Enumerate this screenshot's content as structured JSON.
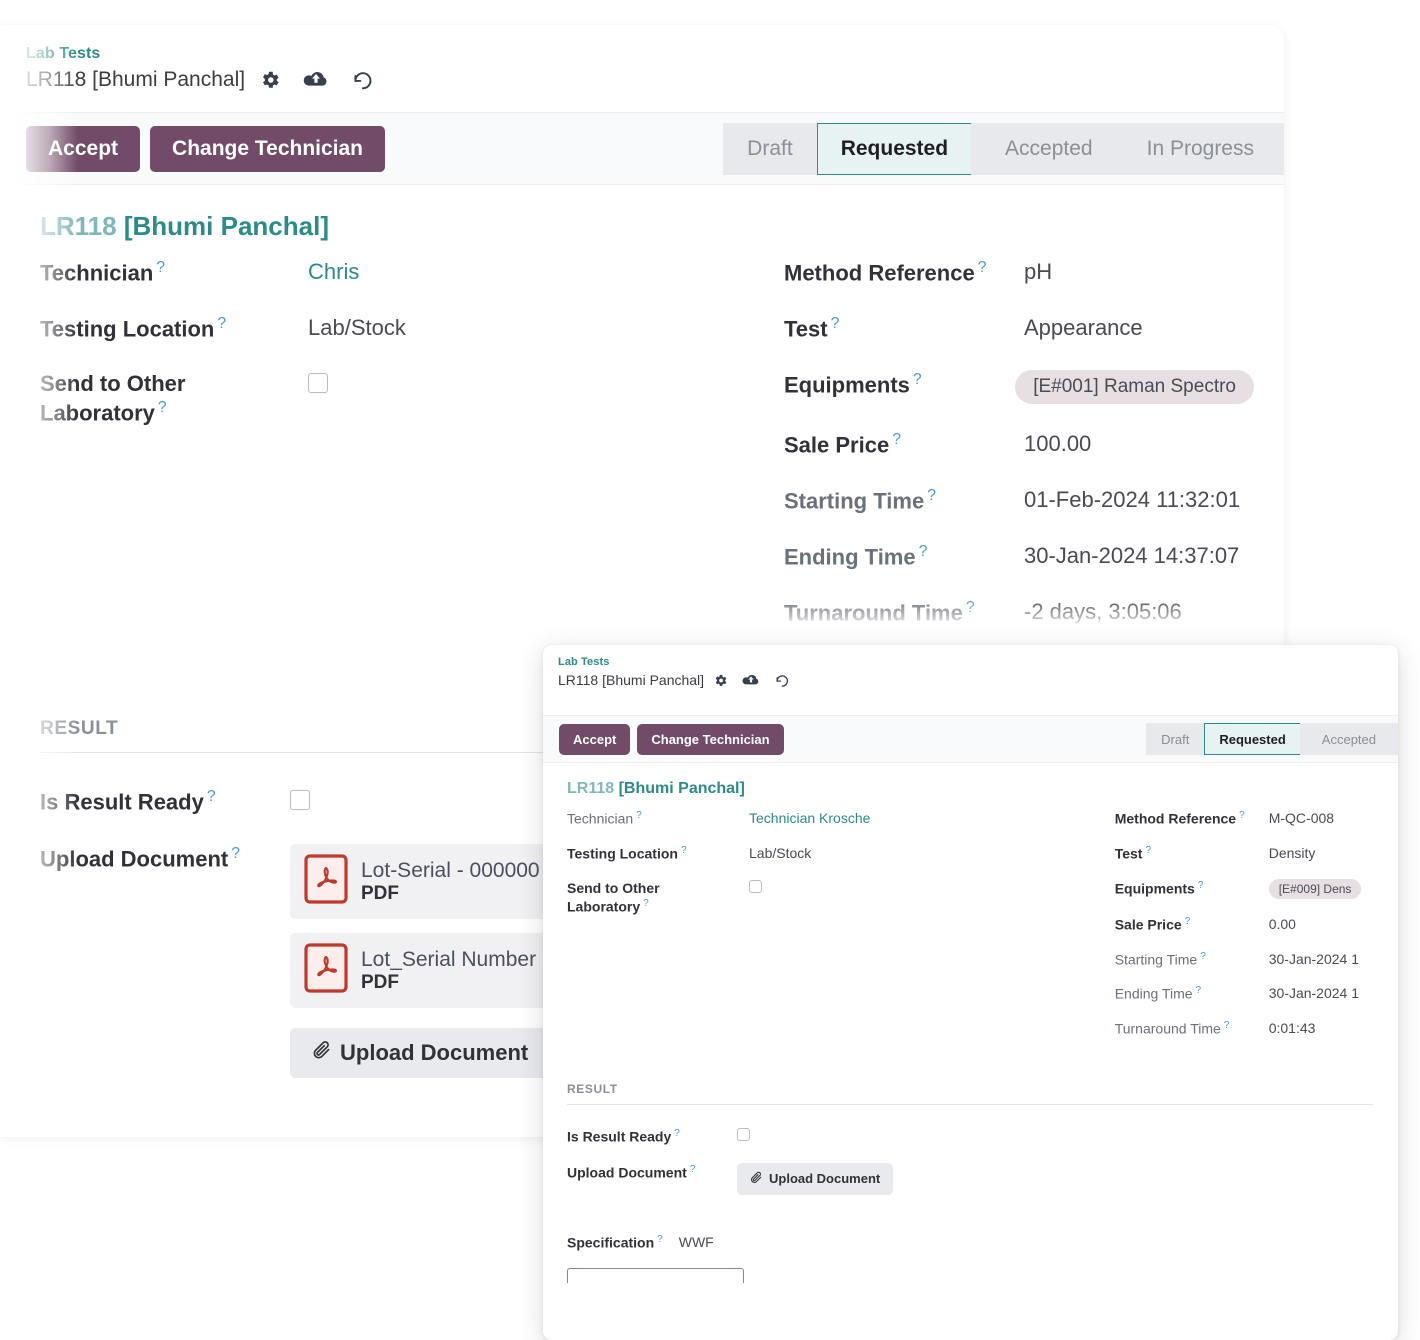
{
  "outer": {
    "breadcrumb": {
      "parent": "Lab Tests",
      "record": "LR118 [Bhumi Panchal]"
    },
    "header_icons": [
      "gear-icon",
      "cloud-upload-icon",
      "undo-icon"
    ],
    "buttons": {
      "accept": "Accept",
      "change_technician": "Change Technician"
    },
    "statusbar": {
      "stages": [
        "Draft",
        "Requested",
        "Accepted",
        "In Progress"
      ],
      "active": "Requested",
      "active_color": "#2e8b8b"
    },
    "sheet_title": {
      "code": "LR118",
      "name": "[Bhumi Panchal]"
    },
    "left_fields": [
      {
        "label": "Technician",
        "value": "Chris",
        "type": "link"
      },
      {
        "label": "Testing Location",
        "value": "Lab/Stock",
        "type": "text"
      },
      {
        "label": "Send to Other Laboratory",
        "value": "",
        "type": "checkbox",
        "checked": false
      }
    ],
    "right_fields": [
      {
        "label": "Method Reference",
        "value": "pH",
        "type": "text"
      },
      {
        "label": "Test",
        "value": "Appearance",
        "type": "text"
      },
      {
        "label": "Equipments",
        "value": "[E#001] Raman Spectro",
        "type": "tag"
      },
      {
        "label": "Sale Price",
        "value": "100.00",
        "type": "text"
      },
      {
        "label": "Starting Time",
        "value": "01-Feb-2024 11:32:01",
        "type": "text"
      },
      {
        "label": "Ending Time",
        "value": "30-Jan-2024 14:37:07",
        "type": "text"
      },
      {
        "label": "Turnaround Time",
        "value": "-2 days, 3:05:06",
        "type": "text"
      }
    ],
    "result": {
      "heading": "RESULT",
      "is_result_ready_label": "Is Result Ready",
      "is_result_ready_checked": false,
      "upload_document_label": "Upload Document",
      "attachments": [
        {
          "name": "Lot-Serial - 000000",
          "type": "PDF"
        },
        {
          "name": "Lot_Serial Number",
          "type": "PDF"
        }
      ],
      "upload_button": "Upload Document"
    }
  },
  "inner": {
    "breadcrumb": {
      "parent": "Lab Tests",
      "record": "LR118 [Bhumi Panchal]"
    },
    "header_icons": [
      "gear-icon",
      "cloud-upload-icon",
      "undo-icon"
    ],
    "buttons": {
      "accept": "Accept",
      "change_technician": "Change Technician"
    },
    "statusbar": {
      "stages": [
        "Draft",
        "Requested",
        "Accepted"
      ],
      "active": "Requested",
      "active_color": "#2e8b8b"
    },
    "sheet_title": {
      "code": "LR118",
      "name": "[Bhumi Panchal]"
    },
    "left_fields": [
      {
        "label": "Technician",
        "value": "Technician Krosche",
        "type": "link"
      },
      {
        "label": "Testing Location",
        "value": "Lab/Stock",
        "type": "text"
      },
      {
        "label": "Send to Other Laboratory",
        "value": "",
        "type": "checkbox",
        "checked": false
      }
    ],
    "right_fields": [
      {
        "label": "Method Reference",
        "value": "M-QC-008",
        "type": "text"
      },
      {
        "label": "Test",
        "value": "Density",
        "type": "text"
      },
      {
        "label": "Equipments",
        "value": "[E#009] Dens",
        "type": "tag"
      },
      {
        "label": "Sale Price",
        "value": "0.00",
        "type": "text"
      },
      {
        "label": "Starting Time",
        "value": "30-Jan-2024 1",
        "type": "text"
      },
      {
        "label": "Ending Time",
        "value": "30-Jan-2024 1",
        "type": "text"
      },
      {
        "label": "Turnaround Time",
        "value": "0:01:43",
        "type": "text"
      }
    ],
    "result": {
      "heading": "RESULT",
      "is_result_ready_label": "Is Result Ready",
      "is_result_ready_checked": false,
      "upload_document_label": "Upload Document",
      "upload_button": "Upload Document",
      "specification_label": "Specification",
      "specification_value": "WWF"
    }
  },
  "theme": {
    "primary": "#714B67",
    "accent_teal": "#2b8a8a",
    "stage_active_border": "#2e8b8b",
    "stage_active_bg": "#e7f3f3",
    "tag_bg": "#e8dfe3",
    "pdf_red": "#c0392b"
  }
}
